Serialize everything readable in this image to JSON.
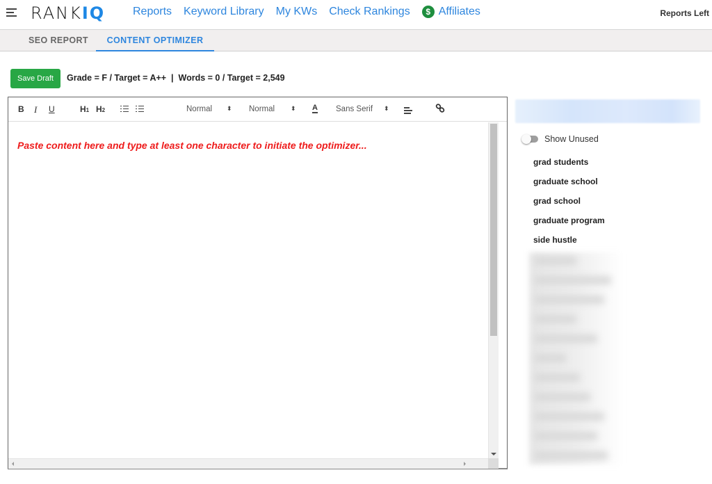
{
  "nav": {
    "logo_main": "RANK",
    "logo_accent": "IQ",
    "links": [
      "Reports",
      "Keyword Library",
      "My KWs",
      "Check Rankings",
      "Affiliates"
    ],
    "affiliates_icon": "$",
    "reports_left": "Reports Left"
  },
  "tabs": [
    {
      "label": "SEO REPORT",
      "active": false
    },
    {
      "label": "CONTENT OPTIMIZER",
      "active": true
    }
  ],
  "grade_row": {
    "save_label": "Save Draft",
    "status_text": "Grade = F / Target = A++  |  Words = 0 / Target = 2,549"
  },
  "editor": {
    "toolbar": {
      "bold": "B",
      "italic": "I",
      "underline": "U",
      "h1": "H",
      "h1_sub": "1",
      "h2": "H",
      "h2_sub": "2",
      "header_select": "Normal",
      "size_select": "Normal",
      "color_label": "A",
      "font_select": "Sans Serif",
      "select_arrow": "⬍"
    },
    "placeholder": "Paste content here and type at least one character to initiate the optimizer..."
  },
  "panel": {
    "show_unused_label": "Show Unused",
    "show_unused_on": false,
    "keywords": [
      "grad students",
      "graduate school",
      "grad school",
      "graduate program",
      "side hustle"
    ]
  },
  "colors": {
    "accent": "#2e86de",
    "save_button": "#28a745",
    "placeholder": "#ee1c1c"
  }
}
